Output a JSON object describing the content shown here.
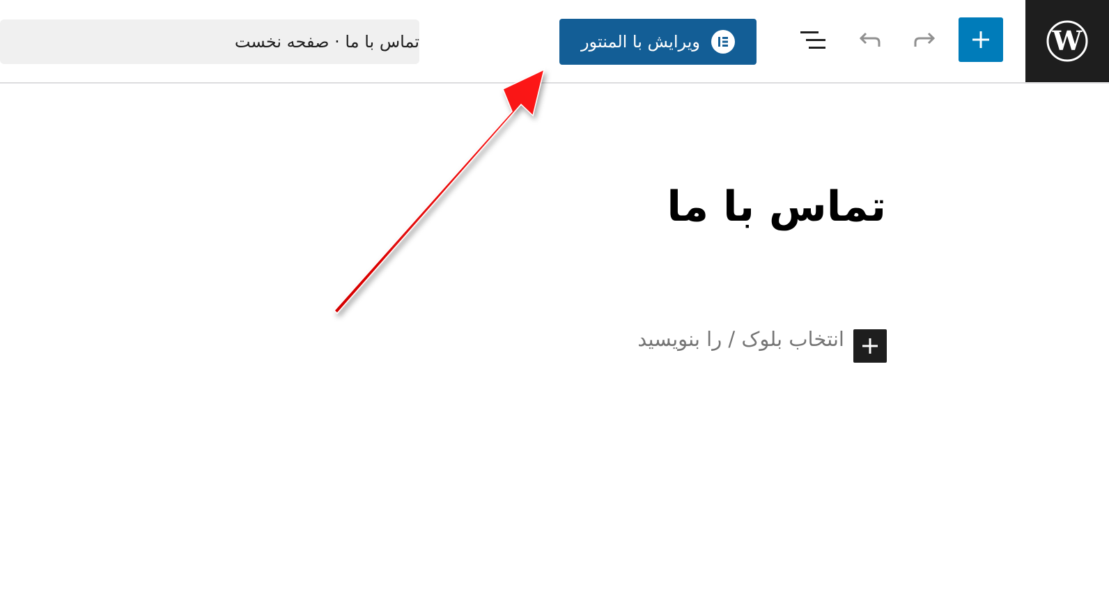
{
  "toolbar": {
    "document_title": "تماس با ما · صفحه نخست",
    "elementor_button_label": "ویرایش با المنتور",
    "icons": {
      "wp_logo": "wordpress-logo-icon",
      "inserter": "plus-icon",
      "redo": "redo-icon",
      "undo": "undo-icon",
      "list_view": "list-view-icon",
      "elementor": "elementor-icon"
    }
  },
  "editor": {
    "post_title": "تماس با ما",
    "block_placeholder": "انتخاب بلوک / را بنویسید"
  },
  "colors": {
    "accent": "#007cba",
    "elementor_button": "#135e96",
    "logo_background": "#1e1e1e",
    "annotation_arrow": "#ff0000"
  }
}
